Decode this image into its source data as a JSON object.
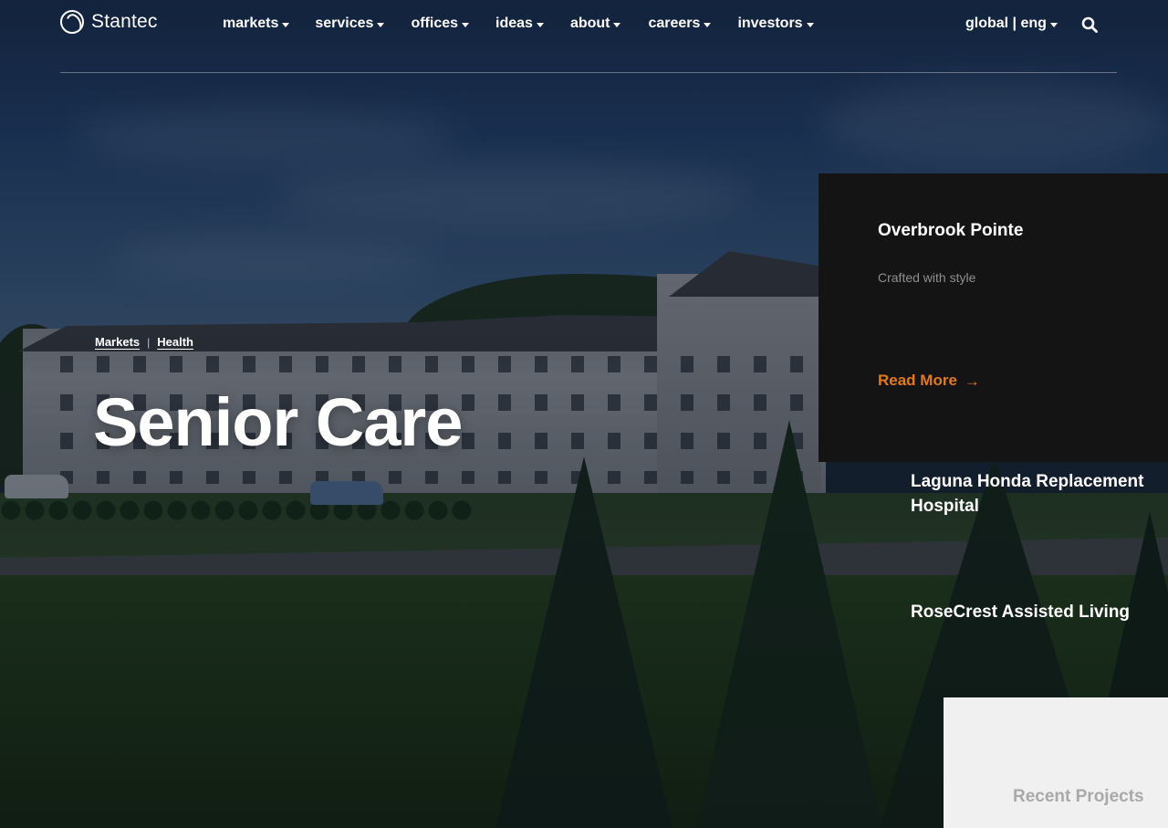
{
  "brand": {
    "name": "Stantec"
  },
  "nav": {
    "items": [
      {
        "label": "markets"
      },
      {
        "label": "services"
      },
      {
        "label": "offices"
      },
      {
        "label": "ideas"
      },
      {
        "label": "about"
      },
      {
        "label": "careers"
      },
      {
        "label": "investors"
      }
    ],
    "locale": "global | eng"
  },
  "breadcrumb": {
    "parent": "Markets",
    "current": "Health",
    "separator": "|"
  },
  "page": {
    "title": "Senior Care"
  },
  "featured_project": {
    "title": "Overbrook Pointe",
    "subtitle": "Crafted with style",
    "cta": "Read More",
    "cta_arrow": "→"
  },
  "projects": [
    {
      "title": "Laguna Honda Replacement Hospital"
    },
    {
      "title": "RoseCrest Assisted Living"
    }
  ],
  "recent": {
    "label": "Recent Projects"
  },
  "colors": {
    "accent": "#e07a1f",
    "panel": "#141414",
    "card": "#f0f0f0"
  },
  "icons": [
    "stantec-logo-icon",
    "caret-down-icon",
    "search-icon",
    "arrow-right-icon"
  ]
}
